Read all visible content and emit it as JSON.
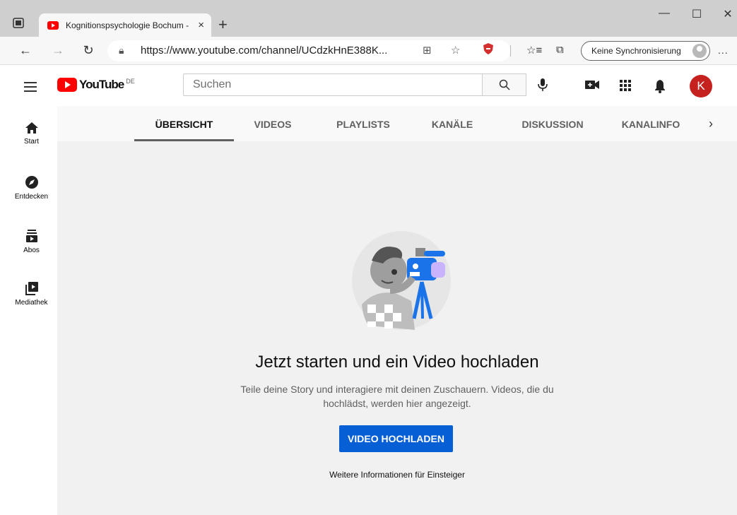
{
  "browser": {
    "tab_title": "Kognitionspsychologie Bochum -",
    "tab_close": "×",
    "new_tab": "+",
    "url": "https://www.youtube.com/channel/UCdzkHnE388K...",
    "sync_label": "Keine Synchronisierung",
    "more": "...",
    "win_min": "—",
    "win_max": "☐",
    "win_close": "✕"
  },
  "youtube": {
    "logo_text": "YouTube",
    "region": "DE",
    "search_placeholder": "Suchen",
    "avatar_letter": "K",
    "accent_color": "#065fd4",
    "avatar_color": "#c5221f"
  },
  "guide": {
    "items": [
      {
        "label": "Start",
        "icon": "home-icon"
      },
      {
        "label": "Entdecken",
        "icon": "compass-icon"
      },
      {
        "label": "Abos",
        "icon": "subscriptions-icon"
      },
      {
        "label": "Mediathek",
        "icon": "library-icon"
      }
    ]
  },
  "channel": {
    "tabs": [
      "ÜBERSICHT",
      "VIDEOS",
      "PLAYLISTS",
      "KANÄLE",
      "DISKUSSION",
      "KANALINFO"
    ],
    "active_tab": "ÜBERSICHT"
  },
  "empty_state": {
    "title": "Jetzt starten und ein Video hochladen",
    "subtitle": "Teile deine Story und interagiere mit deinen Zuschauern. Videos, die du hochlädst, werden hier angezeigt.",
    "upload_button": "VIDEO HOCHLADEN",
    "learn_more": "Weitere Informationen für Einsteiger"
  }
}
